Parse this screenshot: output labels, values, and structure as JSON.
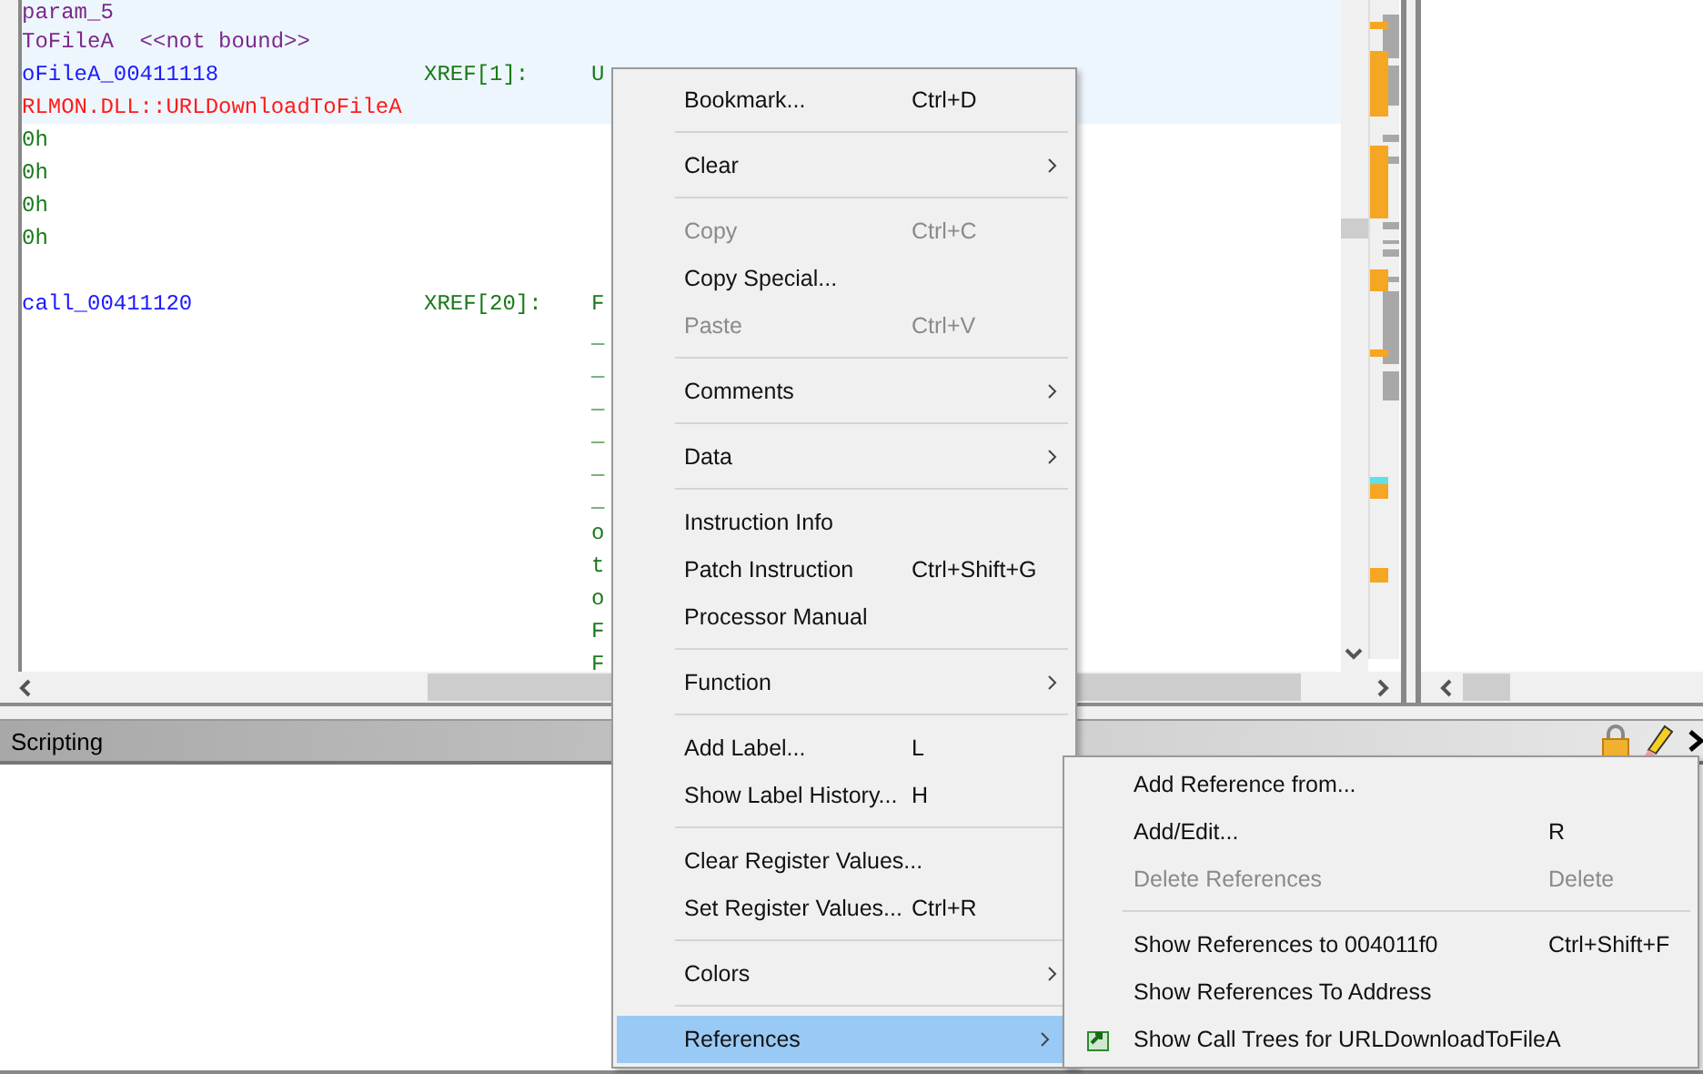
{
  "listing": {
    "lines": [
      {
        "label": "param_5",
        "color": "#7a2a8a",
        "highlighted": true
      },
      {
        "label": "ToFileA  <<not bound>>",
        "color": "#7a2a8a",
        "highlighted": true
      },
      {
        "label": "oFileA_00411118",
        "color": "#1a1aff",
        "xref": "XREF[1]:",
        "operand": "U",
        "highlighted": true
      },
      {
        "label": "RLMON.DLL::URLDownloadToFileA",
        "color": "#ff1a1a",
        "highlighted": true
      },
      {
        "label": "0h",
        "color": "#1a7a1a",
        "highlighted": false
      },
      {
        "label": "0h",
        "color": "#1a7a1a",
        "highlighted": false
      },
      {
        "label": "0h",
        "color": "#1a7a1a",
        "highlighted": false
      },
      {
        "label": "0h",
        "color": "#1a7a1a",
        "highlighted": false
      },
      {
        "highlighted": false
      },
      {
        "label": "call_00411120",
        "color": "#1a1aff",
        "xref": "XREF[20]:",
        "operand": "F",
        "highlighted": false
      },
      {
        "operand": "_",
        "highlighted": false
      },
      {
        "operand": "_",
        "highlighted": false
      },
      {
        "operand": "_",
        "highlighted": false
      },
      {
        "operand": "_",
        "highlighted": false
      },
      {
        "operand": "_",
        "highlighted": false
      },
      {
        "operand": "_",
        "highlighted": false
      },
      {
        "operand": "o",
        "highlighted": false
      },
      {
        "operand": "t",
        "highlighted": false
      },
      {
        "operand": "o",
        "highlighted": false
      },
      {
        "operand": "F",
        "highlighted": false
      },
      {
        "operand": "F",
        "highlighted": false
      }
    ]
  },
  "scripting_panel": {
    "title": "Scripting"
  },
  "context_menu": {
    "items": [
      {
        "kind": "item",
        "label": "Bookmark...",
        "shortcut": "Ctrl+D",
        "submenu": false,
        "disabled": false,
        "selected": false
      },
      {
        "kind": "separator"
      },
      {
        "kind": "item",
        "label": "Clear",
        "submenu": true,
        "disabled": false,
        "selected": false
      },
      {
        "kind": "separator"
      },
      {
        "kind": "item",
        "label": "Copy",
        "shortcut": "Ctrl+C",
        "submenu": false,
        "disabled": true,
        "selected": false
      },
      {
        "kind": "item",
        "label": "Copy Special...",
        "submenu": false,
        "disabled": false,
        "selected": false
      },
      {
        "kind": "item",
        "label": "Paste",
        "shortcut": "Ctrl+V",
        "submenu": false,
        "disabled": true,
        "selected": false
      },
      {
        "kind": "separator"
      },
      {
        "kind": "item",
        "label": "Comments",
        "submenu": true,
        "disabled": false,
        "selected": false
      },
      {
        "kind": "separator"
      },
      {
        "kind": "item",
        "label": "Data",
        "submenu": true,
        "disabled": false,
        "selected": false
      },
      {
        "kind": "separator"
      },
      {
        "kind": "item",
        "label": "Instruction Info",
        "submenu": false,
        "disabled": false,
        "selected": false
      },
      {
        "kind": "item",
        "label": "Patch Instruction",
        "shortcut": "Ctrl+Shift+G",
        "submenu": false,
        "disabled": false,
        "selected": false
      },
      {
        "kind": "item",
        "label": "Processor Manual",
        "submenu": false,
        "disabled": false,
        "selected": false
      },
      {
        "kind": "separator"
      },
      {
        "kind": "item",
        "label": "Function",
        "submenu": true,
        "disabled": false,
        "selected": false
      },
      {
        "kind": "separator"
      },
      {
        "kind": "item",
        "label": "Add Label...",
        "shortcut": "L",
        "submenu": false,
        "disabled": false,
        "selected": false
      },
      {
        "kind": "item",
        "label": "Show Label History...",
        "shortcut": "H",
        "submenu": false,
        "disabled": false,
        "selected": false
      },
      {
        "kind": "separator"
      },
      {
        "kind": "item",
        "label": "Clear Register Values...",
        "submenu": false,
        "disabled": false,
        "selected": false
      },
      {
        "kind": "item",
        "label": "Set Register Values...",
        "shortcut": "Ctrl+R",
        "submenu": false,
        "disabled": false,
        "selected": false
      },
      {
        "kind": "separator"
      },
      {
        "kind": "item",
        "label": "Colors",
        "submenu": true,
        "disabled": false,
        "selected": false
      },
      {
        "kind": "separator"
      },
      {
        "kind": "item",
        "label": "References",
        "submenu": true,
        "disabled": false,
        "selected": true
      }
    ]
  },
  "references_submenu": {
    "items": [
      {
        "kind": "item",
        "label": "Add Reference from...",
        "disabled": false,
        "icon": false
      },
      {
        "kind": "item",
        "label": "Add/Edit...",
        "shortcut": "R",
        "disabled": false,
        "icon": false
      },
      {
        "kind": "item",
        "label": "Delete References",
        "shortcut": "Delete",
        "disabled": true,
        "icon": false
      },
      {
        "kind": "separator"
      },
      {
        "kind": "item",
        "label": "Show References to 004011f0",
        "shortcut": "Ctrl+Shift+F",
        "disabled": false,
        "icon": false
      },
      {
        "kind": "item",
        "label": "Show References To Address",
        "disabled": false,
        "icon": false
      },
      {
        "kind": "item",
        "label": "Show Call Trees for URLDownloadToFileA",
        "disabled": false,
        "icon": true
      }
    ]
  }
}
